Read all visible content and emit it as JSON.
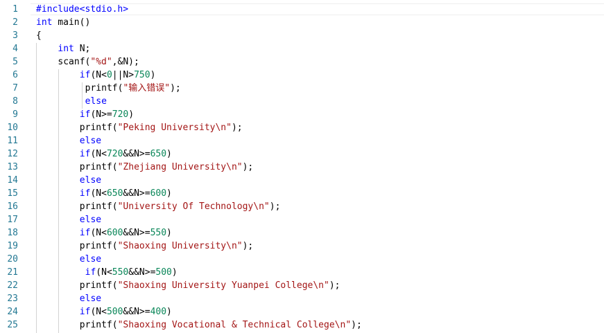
{
  "editor": {
    "colors": {
      "line_number": "#237893",
      "keyword": "#0000ff",
      "string": "#a31515",
      "number": "#098658",
      "default": "#000000",
      "indent_guide": "#d3d3d3"
    },
    "lines": [
      {
        "n": "1",
        "indent": 0,
        "tokens": [
          {
            "t": "#include<stdio.h>",
            "c": "pp"
          }
        ]
      },
      {
        "n": "2",
        "indent": 0,
        "tokens": [
          {
            "t": "int",
            "c": "kw"
          },
          {
            "t": " main()"
          }
        ]
      },
      {
        "n": "3",
        "indent": 0,
        "tokens": [
          {
            "t": "{"
          }
        ]
      },
      {
        "n": "4",
        "indent": 4,
        "tokens": [
          {
            "t": "int",
            "c": "kw"
          },
          {
            "t": " N;"
          }
        ]
      },
      {
        "n": "5",
        "indent": 4,
        "tokens": [
          {
            "t": "scanf("
          },
          {
            "t": "\"%d\"",
            "c": "str"
          },
          {
            "t": ",&N);"
          }
        ]
      },
      {
        "n": "6",
        "indent": 8,
        "tokens": [
          {
            "t": "if",
            "c": "kw"
          },
          {
            "t": "(N<"
          },
          {
            "t": "0",
            "c": "num"
          },
          {
            "t": "||N>"
          },
          {
            "t": "750",
            "c": "num"
          },
          {
            "t": ")"
          }
        ]
      },
      {
        "n": "7",
        "indent": 9,
        "tokens": [
          {
            "t": "printf("
          },
          {
            "t": "\"输入错误\"",
            "c": "str"
          },
          {
            "t": ");"
          }
        ]
      },
      {
        "n": "8",
        "indent": 9,
        "tokens": [
          {
            "t": "else",
            "c": "kw"
          }
        ]
      },
      {
        "n": "9",
        "indent": 8,
        "tokens": [
          {
            "t": "if",
            "c": "kw"
          },
          {
            "t": "(N>="
          },
          {
            "t": "720",
            "c": "num"
          },
          {
            "t": ")"
          }
        ]
      },
      {
        "n": "10",
        "indent": 8,
        "tokens": [
          {
            "t": "printf("
          },
          {
            "t": "\"Peking University\\n\"",
            "c": "str"
          },
          {
            "t": ");"
          }
        ]
      },
      {
        "n": "11",
        "indent": 8,
        "tokens": [
          {
            "t": "else",
            "c": "kw"
          }
        ]
      },
      {
        "n": "12",
        "indent": 8,
        "tokens": [
          {
            "t": "if",
            "c": "kw"
          },
          {
            "t": "(N<"
          },
          {
            "t": "720",
            "c": "num"
          },
          {
            "t": "&&N>="
          },
          {
            "t": "650",
            "c": "num"
          },
          {
            "t": ")"
          }
        ]
      },
      {
        "n": "13",
        "indent": 8,
        "tokens": [
          {
            "t": "printf("
          },
          {
            "t": "\"Zhejiang University\\n\"",
            "c": "str"
          },
          {
            "t": ");"
          }
        ]
      },
      {
        "n": "14",
        "indent": 8,
        "tokens": [
          {
            "t": "else",
            "c": "kw"
          }
        ]
      },
      {
        "n": "15",
        "indent": 8,
        "tokens": [
          {
            "t": "if",
            "c": "kw"
          },
          {
            "t": "(N<"
          },
          {
            "t": "650",
            "c": "num"
          },
          {
            "t": "&&N>="
          },
          {
            "t": "600",
            "c": "num"
          },
          {
            "t": ")"
          }
        ]
      },
      {
        "n": "16",
        "indent": 8,
        "tokens": [
          {
            "t": "printf("
          },
          {
            "t": "\"University Of Technology\\n\"",
            "c": "str"
          },
          {
            "t": ");"
          }
        ]
      },
      {
        "n": "17",
        "indent": 8,
        "tokens": [
          {
            "t": "else",
            "c": "kw"
          }
        ]
      },
      {
        "n": "18",
        "indent": 8,
        "tokens": [
          {
            "t": "if",
            "c": "kw"
          },
          {
            "t": "(N<"
          },
          {
            "t": "600",
            "c": "num"
          },
          {
            "t": "&&N>="
          },
          {
            "t": "550",
            "c": "num"
          },
          {
            "t": ")"
          }
        ]
      },
      {
        "n": "19",
        "indent": 8,
        "tokens": [
          {
            "t": "printf("
          },
          {
            "t": "\"Shaoxing University\\n\"",
            "c": "str"
          },
          {
            "t": ");"
          }
        ]
      },
      {
        "n": "20",
        "indent": 8,
        "tokens": [
          {
            "t": "else",
            "c": "kw"
          }
        ]
      },
      {
        "n": "21",
        "indent": 9,
        "tokens": [
          {
            "t": "if",
            "c": "kw"
          },
          {
            "t": "(N<"
          },
          {
            "t": "550",
            "c": "num"
          },
          {
            "t": "&&N>="
          },
          {
            "t": "500",
            "c": "num"
          },
          {
            "t": ")"
          }
        ]
      },
      {
        "n": "22",
        "indent": 8,
        "tokens": [
          {
            "t": "printf("
          },
          {
            "t": "\"Shaoxing University Yuanpei College\\n\"",
            "c": "str"
          },
          {
            "t": ");"
          }
        ]
      },
      {
        "n": "23",
        "indent": 8,
        "tokens": [
          {
            "t": "else",
            "c": "kw"
          }
        ]
      },
      {
        "n": "24",
        "indent": 8,
        "tokens": [
          {
            "t": "if",
            "c": "kw"
          },
          {
            "t": "(N<"
          },
          {
            "t": "500",
            "c": "num"
          },
          {
            "t": "&&N>="
          },
          {
            "t": "400",
            "c": "num"
          },
          {
            "t": ")"
          }
        ]
      },
      {
        "n": "25",
        "indent": 8,
        "tokens": [
          {
            "t": "printf("
          },
          {
            "t": "\"Shaoxing Vocational & Technical College\\n\"",
            "c": "str"
          },
          {
            "t": ");"
          }
        ]
      }
    ]
  }
}
